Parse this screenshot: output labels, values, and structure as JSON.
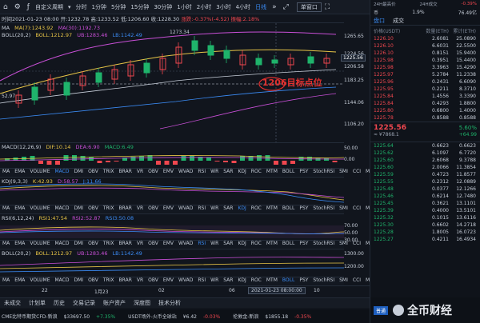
{
  "toolbar": {
    "items": [
      "分时",
      "1分钟",
      "5分钟",
      "15分钟",
      "30分钟",
      "1小时",
      "2小时",
      "3小时",
      "4小时",
      "日线"
    ],
    "active_index": 9,
    "custom_period": "自定义周期",
    "sel": "单窗口"
  },
  "info": {
    "time": "时间2021-01-23 08:00",
    "open": "开:1232.78",
    "high": "高:1233.52",
    "low": "低:1206.60",
    "close": "收:1228.30",
    "change": "涨跌:-0.37%(-4.52)",
    "amplitude": "振幅:2.18%"
  },
  "main_legend": {
    "ma": "MA",
    "ma7": "MA(7):1243.92",
    "ma30": "MA(30):1192.73"
  },
  "boll_legend": {
    "name": "BOLL(20,2)",
    "boll": "BOLL:1212.97",
    "ub": "UB:1283.46",
    "lb": "LB:1142.49"
  },
  "annotations": {
    "max": "1273.34",
    "min": "52.97",
    "target": "1206目标点位"
  },
  "main_axis": [
    "1265.65",
    "1224.56",
    "1206.58",
    "1183.25",
    "1144.06",
    "1106.20"
  ],
  "price_tag": "1225.56",
  "macd_legend": {
    "name": "MACD(12,26,9)",
    "dif": "DIF:10.14",
    "dea": "DEA:6.90",
    "macd": "MACD:6.49"
  },
  "macd_axis": [
    "50.00",
    "0.00"
  ],
  "kdj_legend": {
    "name": "KDJ(9,3,3)",
    "k": "K:42.93",
    "d": "D:58.57",
    "j": "J:11.66"
  },
  "rsi_legend": {
    "name": "RSI(6,12,24)",
    "r1": "RSI1:47.54",
    "r2": "RSI2:52.87",
    "r3": "RSI3:50.08"
  },
  "rsi_axis": [
    "70.00",
    "50.00",
    "30.00"
  ],
  "boll2_legend": {
    "name": "BOLL(20,2)",
    "boll": "BOLL:1212.97",
    "ub": "UB:1283.46",
    "lb": "LB:1142.49"
  },
  "boll2_axis": [
    "1300.00",
    "1200.00"
  ],
  "indicator_tabs": [
    "MA",
    "EMA",
    "VOLUME",
    "MACD",
    "DMI",
    "OBV",
    "TRIX",
    "BRAR",
    "VR",
    "OBV",
    "EMV",
    "WVAD",
    "RSI",
    "WR",
    "SAR",
    "KDJ",
    "ROC",
    "MTM",
    "BOLL",
    "PSY",
    "StochRSI",
    "SMI",
    "CCI",
    "MFI",
    "ATR"
  ],
  "date_axis": [
    "22",
    "1月23",
    "02",
    "06",
    "2021-01-23 08:00:00",
    "10"
  ],
  "right_header": {
    "high24": "24H最高价",
    "vol24": "24H成交",
    "pct": "-0.39%",
    "pct_val": "76.49亿",
    "title": "币",
    "change": "1.9%"
  },
  "right_tabs": [
    "盘口",
    "成交"
  ],
  "ob_cols": [
    "价格(USDT)",
    "数量(ETH)",
    "累计(ETH)"
  ],
  "asks": [
    [
      "1226.10",
      "2.6081",
      "25.0890"
    ],
    [
      "1226.10",
      "6.6031",
      "22.5500"
    ],
    [
      "1226.10",
      "0.8151",
      "15.9400"
    ],
    [
      "1225.98",
      "0.3951",
      "15.4400"
    ],
    [
      "1225.98",
      "3.3963",
      "15.4290"
    ],
    [
      "1225.97",
      "5.2784",
      "11.2338"
    ],
    [
      "1225.96",
      "0.2431",
      "6.6090"
    ],
    [
      "1225.95",
      "0.2211",
      "8.3710"
    ],
    [
      "1225.84",
      "1.4556",
      "3.3390"
    ],
    [
      "1225.84",
      "0.4293",
      "1.8800"
    ],
    [
      "1225.80",
      "0.6800",
      "1.4000"
    ],
    [
      "1225.78",
      "0.8588",
      "0.8588"
    ]
  ],
  "mid": {
    "price": "1225.56",
    "pct": "5.60%",
    "sub": "≈ ¥7868.1",
    "chg": "+64.99"
  },
  "bids": [
    [
      "1225.64",
      "0.6623",
      "0.6623"
    ],
    [
      "1225.62",
      "6.1097",
      "6.7720"
    ],
    [
      "1225.60",
      "2.6068",
      "9.3788"
    ],
    [
      "1225.60",
      "2.0066",
      "11.3854"
    ],
    [
      "1225.59",
      "0.4723",
      "11.8577"
    ],
    [
      "1225.55",
      "0.2312",
      "12.0889"
    ],
    [
      "1225.48",
      "0.0377",
      "12.1266"
    ],
    [
      "1225.46",
      "0.6214",
      "12.7480"
    ],
    [
      "1225.45",
      "0.3621",
      "13.1101"
    ],
    [
      "1225.39",
      "0.4000",
      "13.5101"
    ],
    [
      "1225.32",
      "0.1015",
      "13.6116"
    ],
    [
      "1225.30",
      "0.6602",
      "14.2718"
    ],
    [
      "1225.28",
      "1.8005",
      "16.0723"
    ],
    [
      "1225.27",
      "0.4211",
      "16.4934"
    ]
  ],
  "bottom_tabs": [
    "未成交",
    "计划单",
    "历史",
    "交易记录",
    "账户资产",
    "深度图",
    "技术分析"
  ],
  "ticker": [
    {
      "name": "CME比特币期货CFD-新浪",
      "val": "$33697.50",
      "chg": "+7.35%",
      "up": true
    },
    {
      "name": "USDT场外-火币全球站",
      "val": "¥6.42",
      "chg": "-0.03%",
      "up": false
    },
    {
      "name": "伦敦金-新浪",
      "val": "$1855.18",
      "chg": "-0.35%",
      "up": false
    }
  ],
  "logo": "全币财经",
  "colors": {
    "red": "#f0474f",
    "green": "#1fb36b",
    "blue": "#3b8cf6",
    "yellow": "#e8c547",
    "purple": "#c84fd6"
  }
}
